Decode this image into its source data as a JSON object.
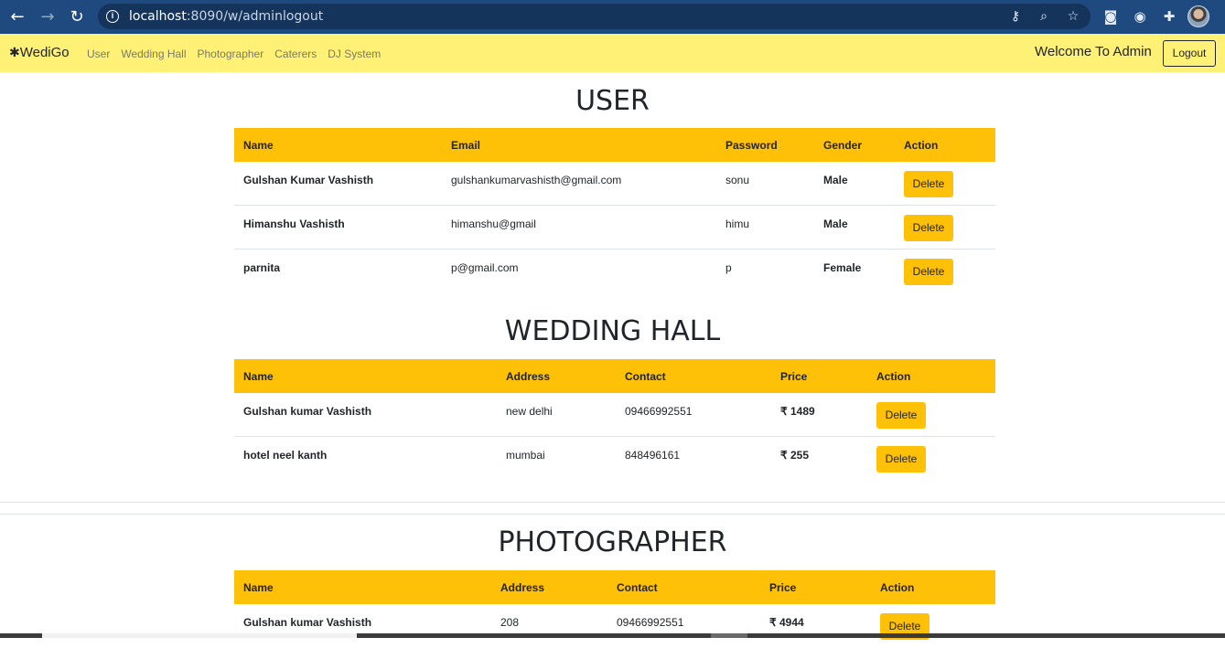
{
  "browser": {
    "url_host": "localhost",
    "url_rest": ":8090/w/adminlogout",
    "back_icon": "←",
    "forward_icon": "→",
    "reload_icon": "↻"
  },
  "navbar": {
    "brand_star": "✱",
    "brand": "WediGo",
    "links": [
      "User",
      "Wedding Hall",
      "Photographer",
      "Caterers",
      "DJ System"
    ],
    "welcome": "Welcome To Admin",
    "logout": "Logout"
  },
  "users": {
    "title": "USER",
    "headers": [
      "Name",
      "Email",
      "Password",
      "Gender",
      "Action"
    ],
    "rows": [
      {
        "name": "Gulshan Kumar Vashisth",
        "email": "gulshankumarvashisth@gmail.com",
        "password": "sonu",
        "gender": "Male",
        "action": "Delete"
      },
      {
        "name": "Himanshu Vashisth",
        "email": "himanshu@gmail",
        "password": "himu",
        "gender": "Male",
        "action": "Delete"
      },
      {
        "name": "parnita",
        "email": "p@gmail.com",
        "password": "p",
        "gender": "Female",
        "action": "Delete"
      }
    ]
  },
  "halls": {
    "title": "WEDDING HALL",
    "headers": [
      "Name",
      "Address",
      "Contact",
      "Price",
      "Action"
    ],
    "rows": [
      {
        "name": "Gulshan kumar Vashisth",
        "address": "new delhi",
        "contact": "09466992551",
        "price": "₹ 1489",
        "action": "Delete"
      },
      {
        "name": "hotel neel kanth",
        "address": "mumbai",
        "contact": "848496161",
        "price": "₹ 255",
        "action": "Delete"
      }
    ]
  },
  "photographers": {
    "title": "PHOTOGRAPHER",
    "headers": [
      "Name",
      "Address",
      "Contact",
      "Price",
      "Action"
    ],
    "rows": [
      {
        "name": "Gulshan kumar Vashisth",
        "address": "208",
        "contact": "09466992551",
        "price": "₹ 4944",
        "action": "Delete"
      }
    ]
  }
}
